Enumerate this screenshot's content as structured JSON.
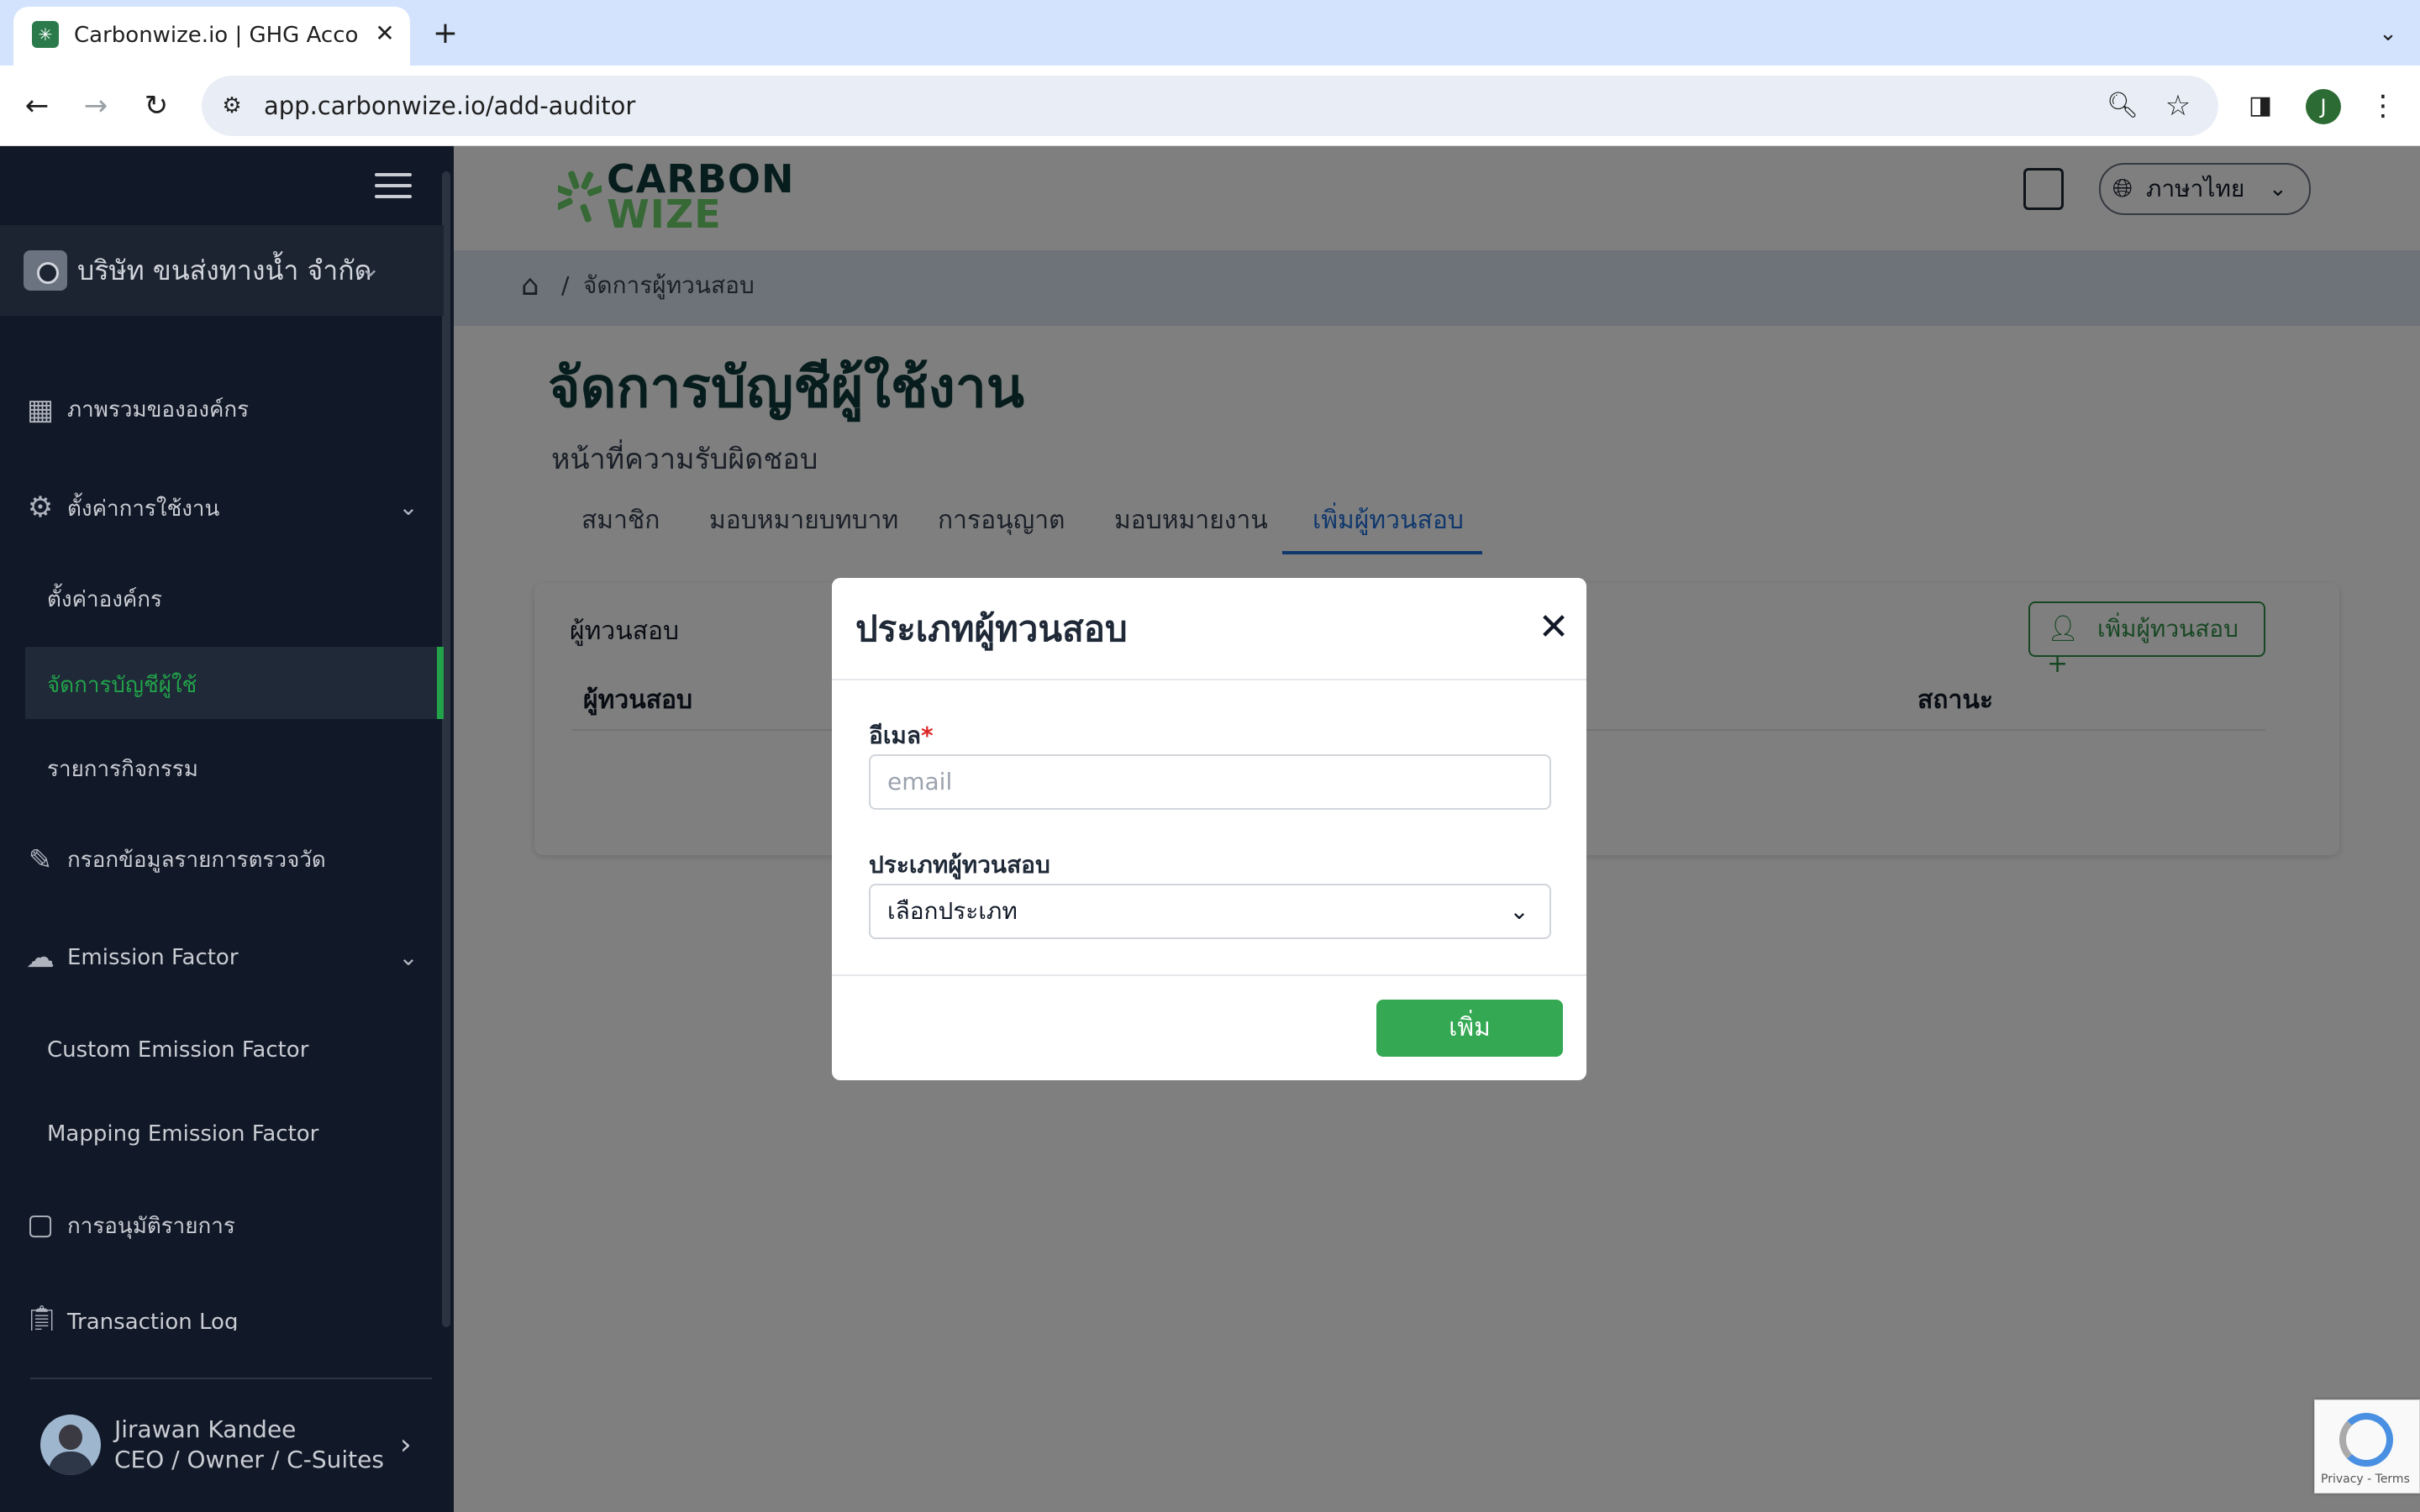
{
  "browser": {
    "tab_title": "Carbonwize.io | GHG Accoun",
    "url": "app.carbonwize.io/add-auditor",
    "profile_initial": "J",
    "new_tab_label": "+",
    "close_tab_label": "✕"
  },
  "sidebar": {
    "org_name": "บริษัท ขนส่งทางน้ำ จำกัด",
    "items": [
      {
        "label": "ภาพรวมขององค์กร",
        "icon": "layout-icon"
      },
      {
        "label": "ตั้งค่าการใช้งาน",
        "icon": "gear-icon"
      },
      {
        "label": "ตั้งค่าองค์กร",
        "icon": ""
      },
      {
        "label": "จัดการบัญชีผู้ใช้",
        "icon": ""
      },
      {
        "label": "รายการกิจกรรม",
        "icon": ""
      },
      {
        "label": "กรอกข้อมูลรายการตรวจวัด",
        "icon": "edit-icon"
      },
      {
        "label": "Emission Factor",
        "icon": "cloud-icon"
      },
      {
        "label": "Custom Emission Factor",
        "icon": ""
      },
      {
        "label": "Mapping Emission Factor",
        "icon": ""
      },
      {
        "label": "การอนุมัติรายการ",
        "icon": "approval-icon"
      },
      {
        "label": "Transaction Log",
        "icon": "clipboard-icon"
      }
    ],
    "active_item": "จัดการบัญชีผู้ใช้",
    "user": {
      "name": "Jirawan Kandee",
      "role": "CEO / Owner / C-Suites"
    }
  },
  "header": {
    "logo_line1": "CARBON",
    "logo_line2": "WIZE",
    "language": "ภาษาไทย"
  },
  "breadcrumb": {
    "separator": "/",
    "current": "จัดการผู้ทวนสอบ"
  },
  "page": {
    "title": "จัดการบัญชีผู้ใช้งาน",
    "subtitle": "หน้าที่ความรับผิดชอบ",
    "tabs": [
      "สมาชิก",
      "มอบหมายบทบาท",
      "การอนุญาต",
      "มอบหมายงาน",
      "เพิ่มผู้ทวนสอบ"
    ],
    "active_tab": "เพิ่มผู้ทวนสอบ",
    "card": {
      "title": "ผู้ทวนสอบ",
      "add_button": "เพิ่มผู้ทวนสอบ",
      "columns": [
        "ผู้ทวนสอบ",
        "สถานะ"
      ]
    }
  },
  "modal": {
    "title": "ประเภทผู้ทวนสอบ",
    "email_label": "อีเมล",
    "required_mark": "*",
    "email_placeholder": "email",
    "type_label": "ประเภทผู้ทวนสอบ",
    "type_selected": "เลือกประเภท",
    "submit_label": "เพิ่ม"
  },
  "recaptcha": {
    "text": "Privacy - Terms"
  },
  "colors": {
    "sidebar_bg": "#111827",
    "accent_green": "#34a853",
    "active_tab_blue": "#1e6fd9",
    "logo_green": "#6dd36a",
    "logo_dark": "#0f3b3a"
  }
}
